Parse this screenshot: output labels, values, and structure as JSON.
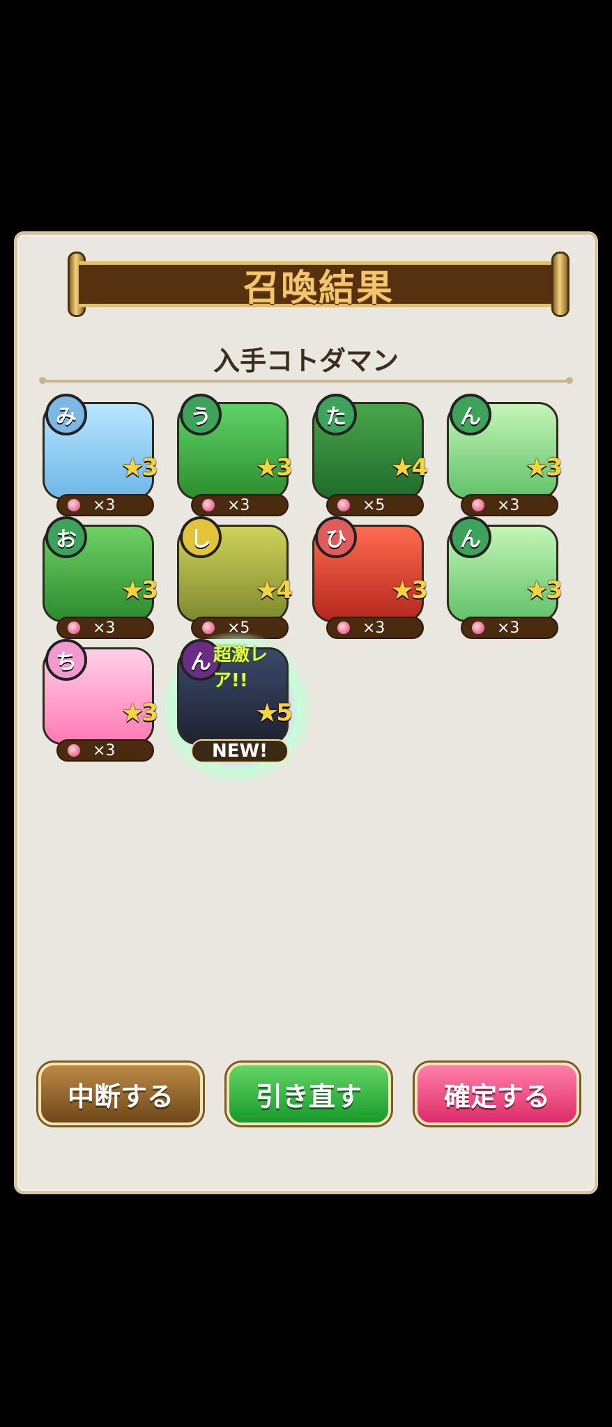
{
  "header": {
    "title": "召喚結果",
    "subtitle": "入手コトダマン"
  },
  "cards": [
    {
      "char": "み",
      "stars": "3",
      "count": "×3",
      "badge_color": "#7bb8e6",
      "bg": "#8fd1ff"
    },
    {
      "char": "う",
      "stars": "3",
      "count": "×3",
      "badge_color": "#3ea35a",
      "bg": "#59c24f"
    },
    {
      "char": "た",
      "stars": "4",
      "count": "×5",
      "badge_color": "#3ea35a",
      "bg": "#2f8f3a"
    },
    {
      "char": "ん",
      "stars": "3",
      "count": "×3",
      "badge_color": "#3ea35a",
      "bg": "#8ee18a"
    },
    {
      "char": "お",
      "stars": "3",
      "count": "×3",
      "badge_color": "#3ea35a",
      "bg": "#58b94f"
    },
    {
      "char": "し",
      "stars": "4",
      "count": "×5",
      "badge_color": "#e2c43a",
      "bg": "#a6b23f"
    },
    {
      "char": "ひ",
      "stars": "3",
      "count": "×3",
      "badge_color": "#e05c5c",
      "bg": "#e24b38"
    },
    {
      "char": "ん",
      "stars": "3",
      "count": "×3",
      "badge_color": "#3ea35a",
      "bg": "#8ee18a"
    },
    {
      "char": "ち",
      "stars": "3",
      "count": "×3",
      "badge_color": "#f29ad0",
      "bg": "#ffb3d6"
    },
    {
      "char": "ん",
      "stars": "5",
      "new_label": "NEW!",
      "rare": "超激レア!!",
      "badge_color": "#6b2c86",
      "bg": "#2b2f3d"
    }
  ],
  "buttons": {
    "stop": "中断する",
    "redraw": "引き直す",
    "confirm": "確定する"
  }
}
